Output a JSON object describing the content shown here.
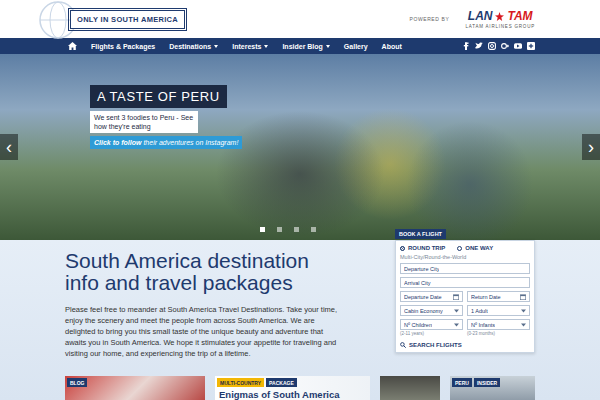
{
  "logo": {
    "text": "ONLY IN SOUTH AMERICA"
  },
  "sponsor": {
    "powered_by": "POWERED BY",
    "brands": [
      {
        "label": "LAN",
        "color": "#1e3a6e"
      },
      {
        "label": "TAM",
        "color": "#d71921"
      }
    ],
    "group": "LATAM AIRLINES GROUP"
  },
  "nav": {
    "items": [
      {
        "label": "Flights & Packages",
        "dropdown": false
      },
      {
        "label": "Destinations",
        "dropdown": true
      },
      {
        "label": "Interests",
        "dropdown": true
      },
      {
        "label": "Insider Blog",
        "dropdown": true
      },
      {
        "label": "Gallery",
        "dropdown": false
      },
      {
        "label": "About",
        "dropdown": false
      }
    ]
  },
  "hero": {
    "title": "A TASTE OF PERU",
    "subtitle": "We sent 3 foodies to Peru - See how they're eating",
    "cta_link": "Click to follow",
    "cta_rest": "their adventures on Instagram!",
    "prev": "‹",
    "next": "›",
    "slides": [
      {
        "selected": true
      },
      {
        "selected": false
      },
      {
        "selected": false
      },
      {
        "selected": false
      }
    ]
  },
  "booking": {
    "tab": "BOOK A FLIGHT",
    "trip_types": [
      {
        "label": "ROUND TRIP",
        "selected": true
      },
      {
        "label": "ONE WAY",
        "selected": false
      }
    ],
    "multi_city": "Multi-City/Round-the-World",
    "rows": [
      [
        {
          "kind": "text",
          "text": "Departure City"
        }
      ],
      [
        {
          "kind": "text",
          "text": "Arrival City"
        }
      ],
      [
        {
          "kind": "date",
          "text": "Departure Date"
        },
        {
          "kind": "date",
          "text": "Return Date"
        }
      ],
      [
        {
          "kind": "select",
          "text": "Cabin Economy"
        },
        {
          "kind": "select",
          "text": "1 Adult"
        }
      ],
      [
        {
          "kind": "select",
          "text": "Nº Children",
          "hint": "(2-11 years)"
        },
        {
          "kind": "select",
          "text": "Nº Infants",
          "hint": "(0-23 months)"
        }
      ]
    ],
    "button": "SEARCH FLIGHTS"
  },
  "intro": {
    "heading": "South America destination info and travel packages",
    "paragraph": "Please feel free to meander at South America Travel Destinations. Take your time, enjoy the scenery and meet the people from across South America. We are delighted to bring you this small taste of the unique beauty and adventure that awaits you in South America. We hope it stimulates your appetite for traveling and visiting our home, and experiencing the trip of a lifetime."
  },
  "cards": [
    {
      "kind": "photo",
      "tags": [
        {
          "label": "BLOG",
          "color": "#1e3a6e"
        }
      ]
    },
    {
      "kind": "text",
      "tags": [
        {
          "label": "MULTI-COUNTRY",
          "color": "#f2b705"
        },
        {
          "label": "PACKAGE",
          "color": "#1e3a6e"
        }
      ],
      "title": "Enigmas of South America"
    },
    {
      "kind": "photo",
      "tags": []
    },
    {
      "kind": "photo",
      "tags": [
        {
          "label": "PERU",
          "color": "#1e3a6e"
        },
        {
          "label": "INSIDER",
          "color": "#1e3a6e"
        }
      ]
    }
  ]
}
